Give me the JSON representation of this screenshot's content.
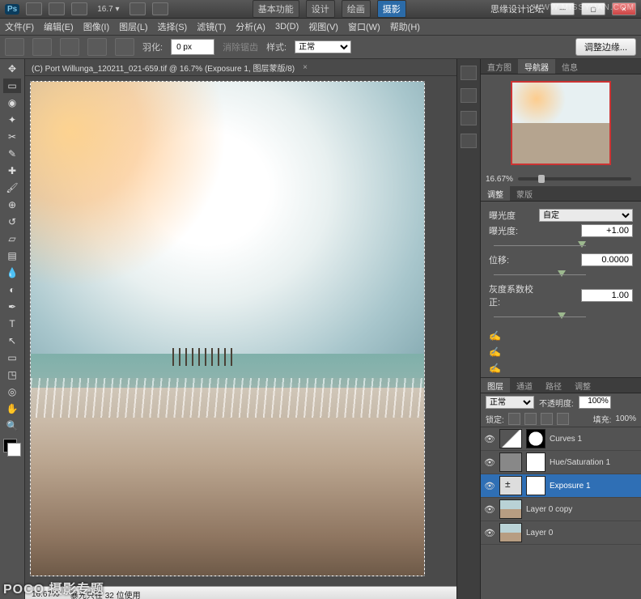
{
  "title": {
    "workspace_buttons": [
      "基本功能",
      "设计",
      "绘画",
      "摄影"
    ],
    "active_ws": 3,
    "forum": "思缘设计论坛",
    "url_wm": "WWW.MISSYUAN.COM",
    "zoom": "16.7 ▾"
  },
  "menu": [
    "文件(F)",
    "编辑(E)",
    "图像(I)",
    "图层(L)",
    "选择(S)",
    "滤镜(T)",
    "分析(A)",
    "3D(D)",
    "视图(V)",
    "窗口(W)",
    "帮助(H)"
  ],
  "options": {
    "feather_label": "羽化:",
    "feather_value": "0 px",
    "antialias": "消除锯齿",
    "style_label": "样式:",
    "style_value": "正常",
    "refine": "调整边缘..."
  },
  "doc": {
    "tab": "(C) Port Willunga_120211_021-659.tif @ 16.7% (Exposure 1, 图层蒙版/8)",
    "close": "×"
  },
  "status": {
    "zoom": "16.67%",
    "info": "暴光只在 32 位使用"
  },
  "nav": {
    "tabs": [
      "直方图",
      "导航器",
      "信息"
    ],
    "active": 1,
    "zoom": "16.67%"
  },
  "adjust": {
    "tabs": [
      "调整",
      "蒙版"
    ],
    "active": 0,
    "preset_label": "曝光度",
    "preset_value": "自定",
    "rows": [
      {
        "label": "曝光度:",
        "value": "+1.00",
        "knob": 62
      },
      {
        "label": "位移:",
        "value": "0.0000",
        "knob": 48
      },
      {
        "label": "灰度系数校正:",
        "value": "1.00",
        "knob": 48
      }
    ]
  },
  "bottomtabs": {
    "tabs": [
      "图层",
      "通道",
      "路径",
      "调整"
    ],
    "active": 0
  },
  "layeropts": {
    "blend": "正常",
    "opacity_label": "不透明度:",
    "opacity": "100%",
    "lock_label": "锁定:",
    "fill_label": "填充:",
    "fill": "100%"
  },
  "layers": [
    {
      "name": "Curves 1",
      "thumb": "curves",
      "mask": "shaped",
      "sel": false
    },
    {
      "name": "Hue/Saturation 1",
      "thumb": "hs",
      "mask": "plain",
      "sel": false
    },
    {
      "name": "Exposure 1",
      "thumb": "exp",
      "mask": "plain",
      "sel": true
    },
    {
      "name": "Layer 0 copy",
      "thumb": "img",
      "mask": "",
      "sel": false
    },
    {
      "name": "Layer 0",
      "thumb": "img",
      "mask": "",
      "sel": false
    }
  ],
  "watermark": "POCO 摄影专题"
}
